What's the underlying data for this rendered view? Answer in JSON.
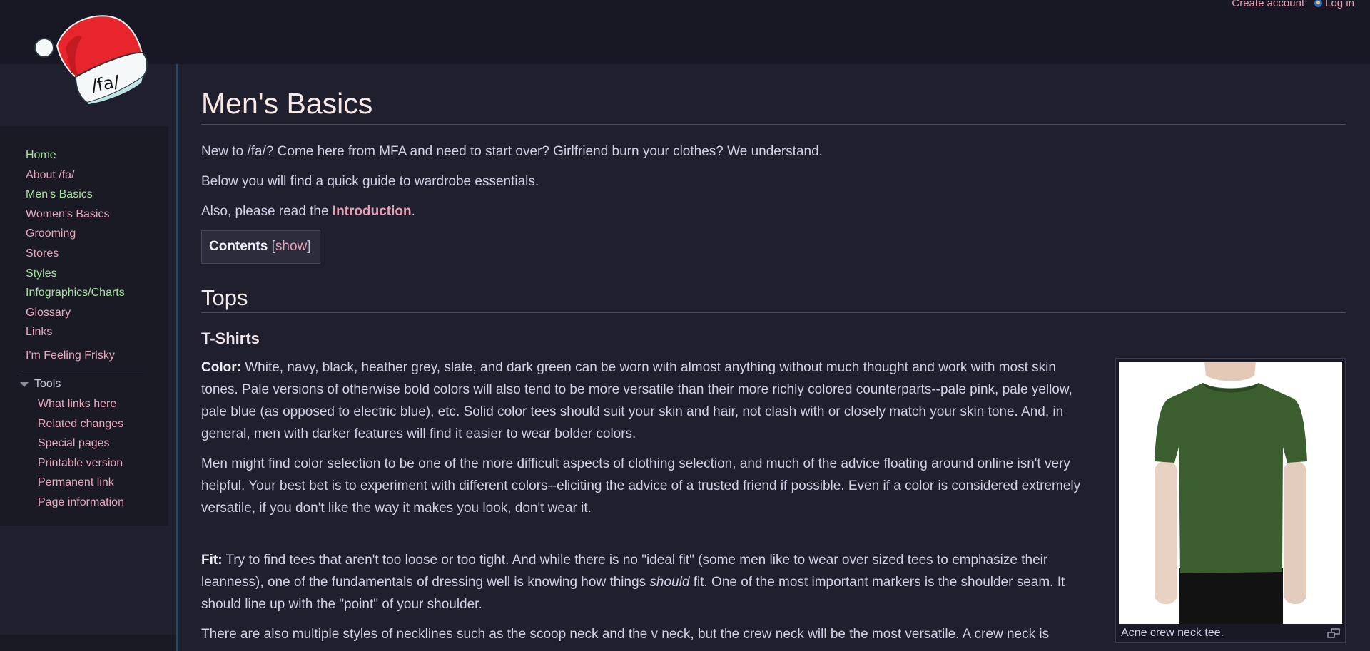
{
  "header": {
    "logo_text": "/fa/",
    "create_account": "Create account",
    "log_in": "Log in"
  },
  "sidebar": {
    "nav_items": [
      {
        "label": "Home",
        "color": "green"
      },
      {
        "label": "About /fa/",
        "color": "pink"
      },
      {
        "label": "Men's Basics",
        "color": "green"
      },
      {
        "label": "Women's Basics",
        "color": "pink"
      },
      {
        "label": "Grooming",
        "color": "pink"
      },
      {
        "label": "Stores",
        "color": "pink"
      },
      {
        "label": "Styles",
        "color": "green"
      },
      {
        "label": "Infographics/Charts",
        "color": "green"
      },
      {
        "label": "Glossary",
        "color": "pink"
      },
      {
        "label": "Links",
        "color": "pink"
      }
    ],
    "frisky": "I'm Feeling Frisky",
    "tools_heading": "Tools",
    "tools": [
      "What links here",
      "Related changes",
      "Special pages",
      "Printable version",
      "Permanent link",
      "Page information"
    ]
  },
  "page": {
    "title": "Men's Basics",
    "intro": [
      "New to /fa/? Come here from MFA and need to start over? Girlfriend burn your clothes? We understand.",
      "Below you will find a quick guide to wardrobe essentials."
    ],
    "intro_read_prefix": "Also, please read the ",
    "intro_read_link": "Introduction",
    "intro_read_suffix": ".",
    "toc": {
      "title": "Contents",
      "open_bracket": " [",
      "toggle": "show",
      "close_bracket": "]"
    },
    "section_tops": "Tops",
    "subsection_tshirts": "T-Shirts",
    "color_label": "Color:",
    "color_text": " White, navy, black, heather grey, slate, and dark green can be worn with almost anything without much thought and work with most skin tones. Pale versions of otherwise bold colors will also tend to be more versatile than their more richly colored counterparts--pale pink, pale yellow, pale blue (as opposed to electric blue), etc. Solid color tees should suit your skin and hair, not clash with or closely match your skin tone. And, in general, men with darker features will find it easier to wear bolder colors.",
    "color_para2": "Men might find color selection to be one of the more difficult aspects of clothing selection, and much of the advice floating around online isn't very helpful. Your best bet is to experiment with different colors--eliciting the advice of a trusted friend if possible. Even if a color is considered extremely versatile, if you don't like the way it makes you look, don't wear it.",
    "fit_label": "Fit:",
    "fit_text_a": " Try to find tees that aren't too loose or too tight. And while there is no \"ideal fit\" (some men like to wear over sized tees to emphasize their leanness), one of the fundamentals of dressing well is knowing how things ",
    "fit_em": "should",
    "fit_text_b": " fit. One of the most important markers is the shoulder seam. It should line up with the \"point\" of your shoulder.",
    "neck_para": "There are also multiple styles of necklines such as the scoop neck and the v neck, but the crew neck will be the most versatile. A crew neck is",
    "thumb_caption": "Acne crew neck tee."
  },
  "colors": {
    "background": "#1f1f2d",
    "header_bg": "#181824",
    "link_pink": "#e8a0b4",
    "link_green": "#a8e0a0",
    "accent_border": "#1d4a6e"
  }
}
